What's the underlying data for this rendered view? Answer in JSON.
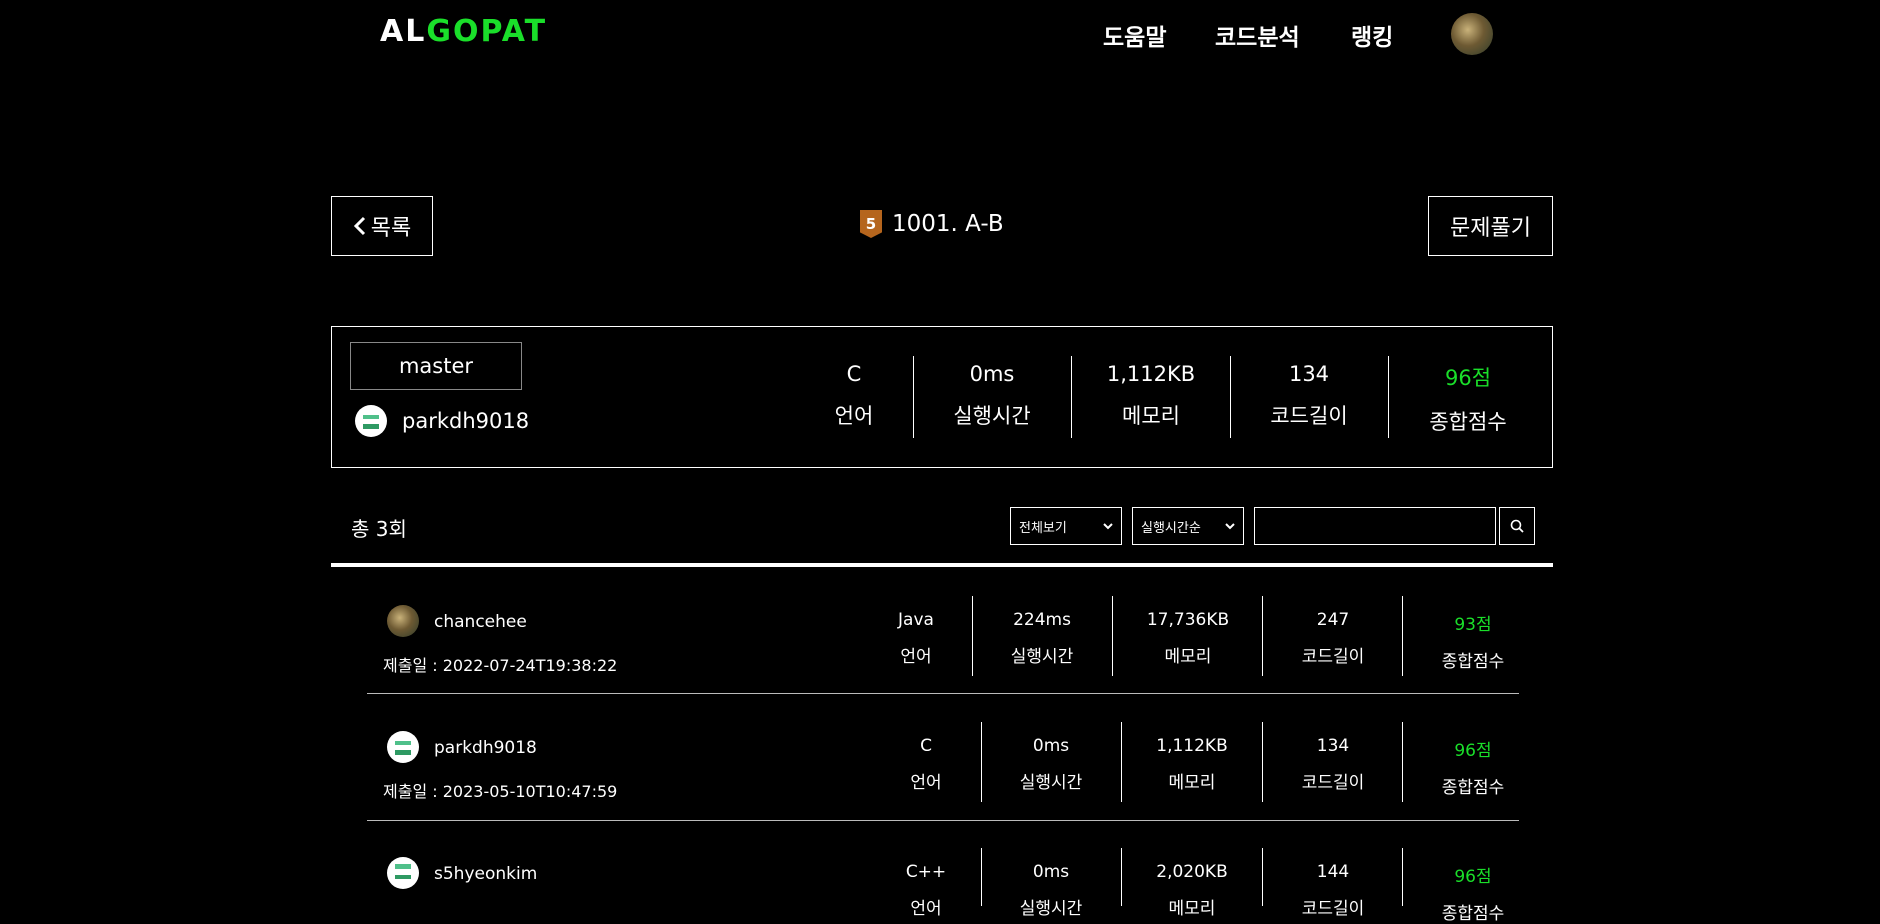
{
  "header": {
    "logo_parts": [
      "AL",
      "G",
      "O",
      "P",
      "A",
      "T"
    ],
    "nav": [
      "도움말",
      "코드분석",
      "랭킹"
    ]
  },
  "toolbar": {
    "back_label": "목록",
    "tier_badge": "5",
    "problem_title": "1001. A-B",
    "solve_label": "문제풀기"
  },
  "summary": {
    "branch": "master",
    "username": "parkdh9018",
    "stats": [
      {
        "value": "C",
        "label": "언어"
      },
      {
        "value": "0ms",
        "label": "실행시간"
      },
      {
        "value": "1,112KB",
        "label": "메모리"
      },
      {
        "value": "134",
        "label": "코드길이"
      },
      {
        "value": "96점",
        "label": "종합점수"
      }
    ]
  },
  "filter": {
    "total": "총 3회",
    "view_select": "전체보기",
    "sort_select": "실행시간순",
    "search_value": ""
  },
  "submissions": [
    {
      "username": "chancehee",
      "date": "제출일 : 2022-07-24T19:38:22",
      "stats": [
        {
          "value": "Java",
          "label": "언어"
        },
        {
          "value": "224ms",
          "label": "실행시간"
        },
        {
          "value": "17,736KB",
          "label": "메모리"
        },
        {
          "value": "247",
          "label": "코드길이"
        },
        {
          "value": "93점",
          "label": "종합점수"
        }
      ]
    },
    {
      "username": "parkdh9018",
      "date": "제출일 : 2023-05-10T10:47:59",
      "stats": [
        {
          "value": "C",
          "label": "언어"
        },
        {
          "value": "0ms",
          "label": "실행시간"
        },
        {
          "value": "1,112KB",
          "label": "메모리"
        },
        {
          "value": "134",
          "label": "코드길이"
        },
        {
          "value": "96점",
          "label": "종합점수"
        }
      ]
    },
    {
      "username": "s5hyeonkim",
      "date": "",
      "stats": [
        {
          "value": "C++",
          "label": "언어"
        },
        {
          "value": "0ms",
          "label": "실행시간"
        },
        {
          "value": "2,020KB",
          "label": "메모리"
        },
        {
          "value": "144",
          "label": "코드길이"
        },
        {
          "value": "96점",
          "label": "종합점수"
        }
      ]
    }
  ],
  "colors": {
    "accent": "#1adf2a",
    "tier_bronze": "#b5651d",
    "avatar_green": "#4fc08a"
  }
}
